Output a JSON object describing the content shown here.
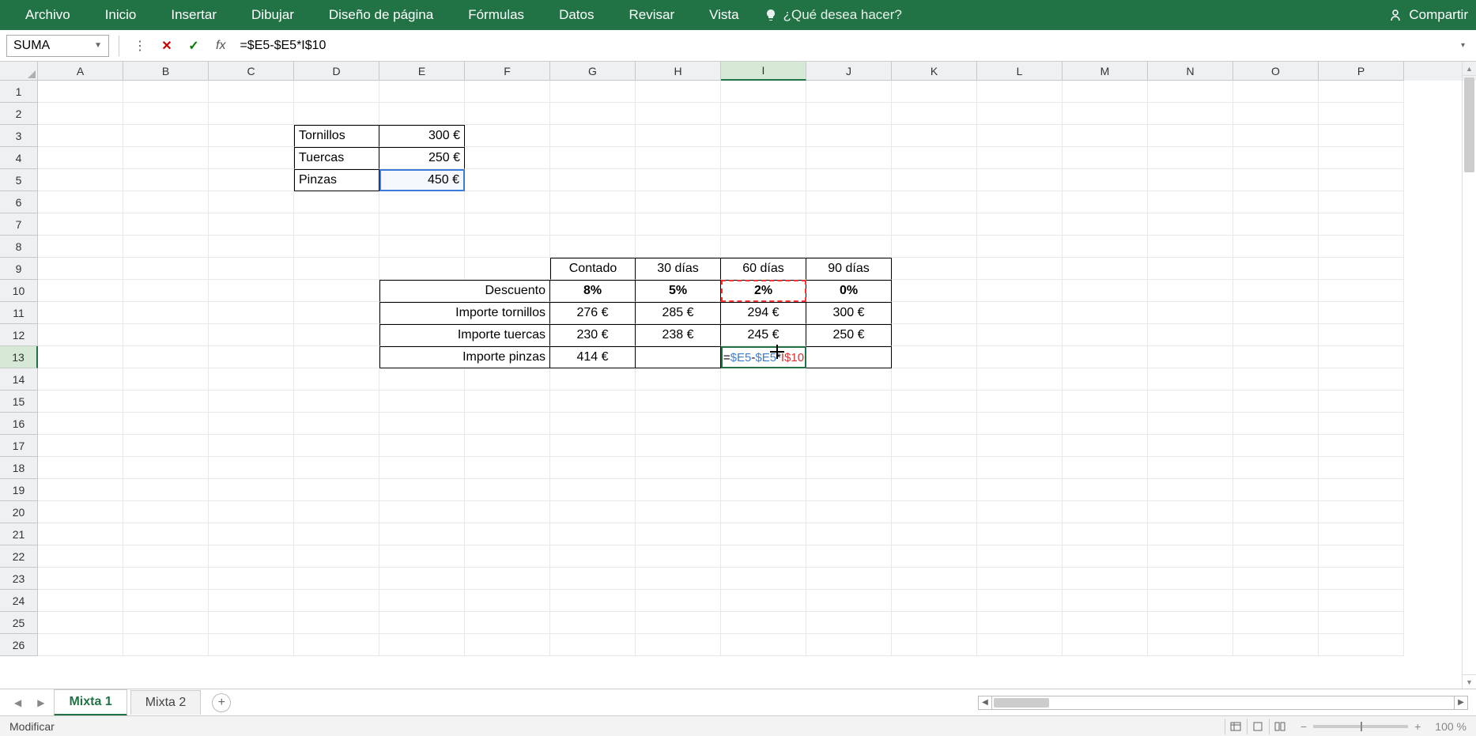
{
  "ribbon": {
    "tabs": [
      "Archivo",
      "Inicio",
      "Insertar",
      "Dibujar",
      "Diseño de página",
      "Fórmulas",
      "Datos",
      "Revisar",
      "Vista"
    ],
    "tell_me": "¿Qué desea hacer?",
    "share": "Compartir"
  },
  "formula_bar": {
    "name_box": "SUMA",
    "formula": "=$E5-$E5*I$10"
  },
  "columns": [
    "A",
    "B",
    "C",
    "D",
    "E",
    "F",
    "G",
    "H",
    "I",
    "J",
    "K",
    "L",
    "M",
    "N",
    "O",
    "P"
  ],
  "active_col": "I",
  "active_row": "13",
  "table1": {
    "rows": [
      {
        "label": "Tornillos",
        "value": "300 €"
      },
      {
        "label": "Tuercas",
        "value": "250 €"
      },
      {
        "label": "Pinzas",
        "value": "450 €"
      }
    ]
  },
  "table2": {
    "col_headers": [
      "Contado",
      "30 días",
      "60 días",
      "90 días"
    ],
    "rows": [
      {
        "label": "Descuento",
        "vals": [
          "8%",
          "5%",
          "2%",
          "0%"
        ],
        "bold": true
      },
      {
        "label": "Importe tornillos",
        "vals": [
          "276 €",
          "285 €",
          "294 €",
          "300 €"
        ]
      },
      {
        "label": "Importe tuercas",
        "vals": [
          "230 €",
          "238 €",
          "245 €",
          "250 €"
        ]
      },
      {
        "label": "Importe pinzas",
        "vals": [
          "414 €",
          "",
          "=$E5-$E5*I$10",
          ""
        ]
      }
    ]
  },
  "edit_cell_parts": {
    "p1": "=",
    "p2": "$E5",
    "p3": "-",
    "p4": "$E5",
    "p5": "*",
    "p6": "I$10"
  },
  "sheets": {
    "tabs": [
      "Mixta 1",
      "Mixta 2"
    ],
    "active": 0
  },
  "status": {
    "mode": "Modificar",
    "zoom": "100 %"
  }
}
